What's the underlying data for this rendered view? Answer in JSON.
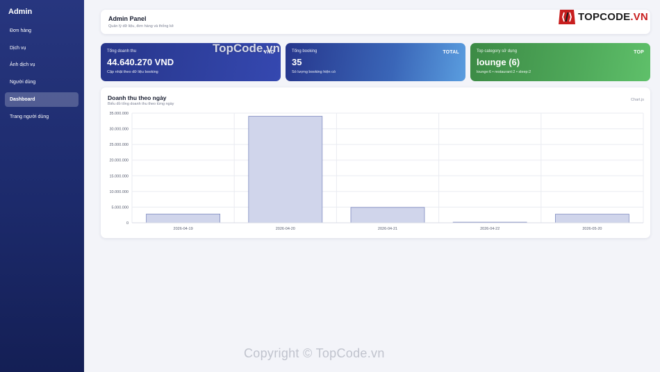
{
  "sidebar": {
    "brand": "Admin",
    "items": [
      {
        "label": "Đơn hàng",
        "active": false
      },
      {
        "label": "Dịch vụ",
        "active": false
      },
      {
        "label": "Ảnh dịch vụ",
        "active": false
      },
      {
        "label": "Người dùng",
        "active": false
      },
      {
        "label": "Dashboard",
        "active": true
      },
      {
        "label": "Trang người dùng",
        "active": false
      }
    ]
  },
  "header": {
    "title": "Admin Panel",
    "subtitle": "Quản lý dữ liệu, đơn hàng và thống kê",
    "logo": {
      "icon": "topcode-logo-icon",
      "text": "TOPCODE",
      "suffix": ".VN"
    }
  },
  "cards": [
    {
      "label": "Tổng doanh thu",
      "value": "44.640.270 VND",
      "note": "Cập nhật theo dữ liệu booking",
      "tag": "VND"
    },
    {
      "label": "Tổng booking",
      "value": "35",
      "note": "Số lượng booking hiện có",
      "tag": "TOTAL"
    },
    {
      "label": "Top category sử dụng",
      "value": "lounge (6)",
      "note": "lounge:6 • restaurant:2 • sleep:2",
      "tag": "TOP"
    }
  ],
  "chart_panel": {
    "title": "Doanh thu theo ngày",
    "subtitle": "Biểu đồ tổng doanh thu theo từng ngày",
    "badge": "Chart.js"
  },
  "chart_data": {
    "type": "bar",
    "categories": [
      "2026-04-19",
      "2026-04-20",
      "2026-04-21",
      "2026-04-22",
      "2026-05-20"
    ],
    "values": [
      2800000,
      34000000,
      4900000,
      200000,
      2750000
    ],
    "ylim": [
      0,
      35000000
    ],
    "yticks": [
      0,
      5000000,
      10000000,
      15000000,
      20000000,
      25000000,
      30000000,
      35000000
    ],
    "ytick_labels": [
      "0",
      "5.000.000",
      "10.000.000",
      "15.000.000",
      "20.000.000",
      "25.000.000",
      "30.000.000",
      "35.000.000"
    ],
    "grid": true,
    "colors": {
      "bar_fill": "#d0d5eb",
      "bar_stroke": "#7f8bc0",
      "grid": "#e9ebf1"
    }
  },
  "watermarks": [
    "TopCode.vn",
    "Copyright © TopCode.vn"
  ]
}
